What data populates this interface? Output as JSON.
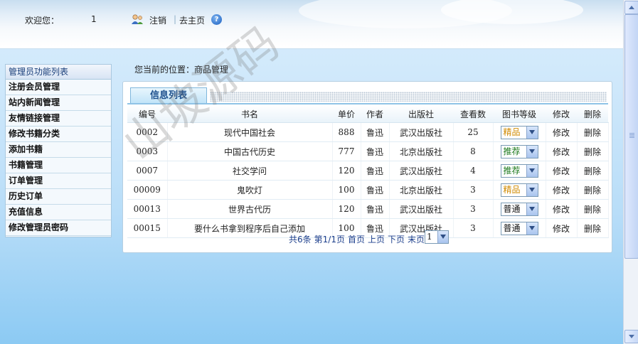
{
  "header": {
    "welcome_label": "欢迎您：",
    "username": "1",
    "logout_label": "注销",
    "separator": "|",
    "home_label": "去主页",
    "help_glyph": "?"
  },
  "sidebar": {
    "title": "管理员功能列表",
    "items": [
      {
        "label": "注册会员管理"
      },
      {
        "label": "站内新闻管理"
      },
      {
        "label": "友情链接管理"
      },
      {
        "label": "修改书籍分类"
      },
      {
        "label": "添加书籍"
      },
      {
        "label": "书籍管理"
      },
      {
        "label": "订单管理"
      },
      {
        "label": "历史订单"
      },
      {
        "label": "充值信息"
      },
      {
        "label": "修改管理员密码"
      }
    ]
  },
  "breadcrumb": "您当前的位置：商品管理",
  "panel": {
    "tab_title": "信息列表",
    "columns": [
      "编号",
      "书名",
      "单价",
      "作者",
      "出版社",
      "查看数",
      "图书等级",
      "修改",
      "删除"
    ],
    "rows": [
      {
        "id": "0002",
        "title": "现代中国社会",
        "price": "888",
        "author": "鲁迅",
        "publisher": "武汉出版社",
        "views": "25",
        "level": "精品",
        "level_color": "#d08a00",
        "edit": "修改",
        "delete": "删除"
      },
      {
        "id": "0003",
        "title": "中国古代历史",
        "price": "777",
        "author": "鲁迅",
        "publisher": "北京出版社",
        "views": "8",
        "level": "推荐",
        "level_color": "#1d7a1d",
        "edit": "修改",
        "delete": "删除"
      },
      {
        "id": "0007",
        "title": "社交学问",
        "price": "120",
        "author": "鲁迅",
        "publisher": "武汉出版社",
        "views": "4",
        "level": "推荐",
        "level_color": "#1d7a1d",
        "edit": "修改",
        "delete": "删除"
      },
      {
        "id": "00009",
        "title": "鬼吹灯",
        "price": "100",
        "author": "鲁迅",
        "publisher": "北京出版社",
        "views": "3",
        "level": "精品",
        "level_color": "#d08a00",
        "edit": "修改",
        "delete": "删除"
      },
      {
        "id": "00013",
        "title": "世界古代历",
        "price": "120",
        "author": "鲁迅",
        "publisher": "武汉出版社",
        "views": "3",
        "level": "普通",
        "level_color": "#111111",
        "edit": "修改",
        "delete": "删除"
      },
      {
        "id": "00015",
        "title": "要什么书拿到程序后自己添加",
        "price": "100",
        "author": "鲁迅",
        "publisher": "武汉出版社",
        "views": "3",
        "level": "普通",
        "level_color": "#111111",
        "edit": "修改",
        "delete": "删除"
      }
    ]
  },
  "pager": {
    "total": "共6条",
    "page_info": "第1/1页",
    "first": "首页",
    "prev": "上页",
    "next": "下页",
    "last": "末页",
    "selected_page": "1"
  },
  "watermark": "山坡源码",
  "icons": {
    "user": "user-icon",
    "help": "help-icon",
    "dropdown": "chevron-down-icon"
  }
}
